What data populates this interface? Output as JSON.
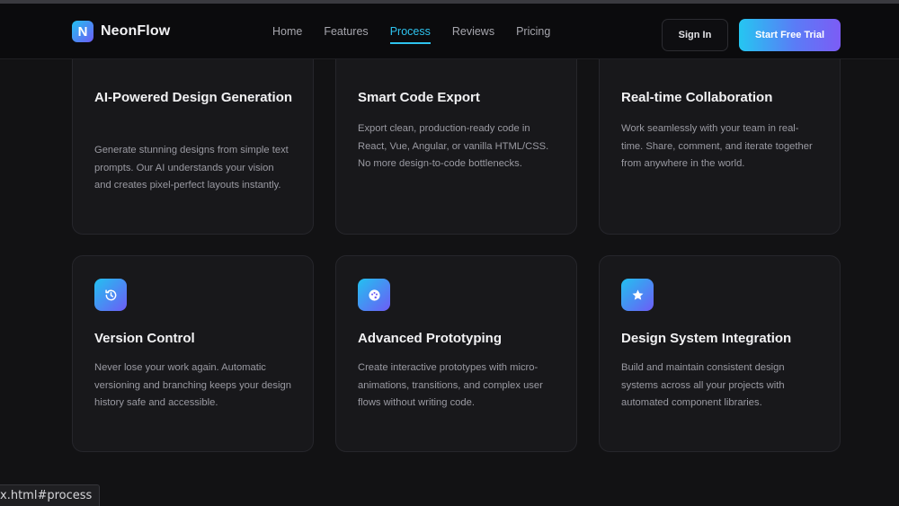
{
  "header": {
    "brand_letter": "N",
    "brand_name": "NeonFlow",
    "nav": [
      {
        "label": "Home"
      },
      {
        "label": "Features"
      },
      {
        "label": "Process"
      },
      {
        "label": "Reviews"
      },
      {
        "label": "Pricing"
      }
    ],
    "active_nav": "Process",
    "sign_in_label": "Sign In",
    "trial_label": "Start Free Trial"
  },
  "features": [
    {
      "title": "AI-Powered Design Generation",
      "description": "Generate stunning designs from simple text prompts. Our AI understands your vision and creates pixel-perfect layouts instantly.",
      "icon": "sparkle-icon"
    },
    {
      "title": "Smart Code Export",
      "description": "Export clean, production-ready code in React, Vue, Angular, or vanilla HTML/CSS. No more design-to-code bottlenecks.",
      "icon": "code-icon"
    },
    {
      "title": "Real-time Collaboration",
      "description": "Work seamlessly with your team in real-time. Share, comment, and iterate together from anywhere in the world.",
      "icon": "users-icon"
    },
    {
      "title": "Version Control",
      "description": "Never lose your work again. Automatic versioning and branching keeps your design history safe and accessible.",
      "icon": "history-icon"
    },
    {
      "title": "Advanced Prototyping",
      "description": "Create interactive prototypes with micro-animations, transitions, and complex user flows without writing code.",
      "icon": "palette-icon"
    },
    {
      "title": "Design System Integration",
      "description": "Build and maintain consistent design systems across all your projects with automated component libraries.",
      "icon": "star-icon"
    }
  ],
  "status_bar": {
    "url_text": "x.html#process"
  },
  "colors": {
    "accent_cyan": "#2ec3ee",
    "accent_violet": "#6d5cf6",
    "background": "#121214",
    "card": "#18181b"
  }
}
